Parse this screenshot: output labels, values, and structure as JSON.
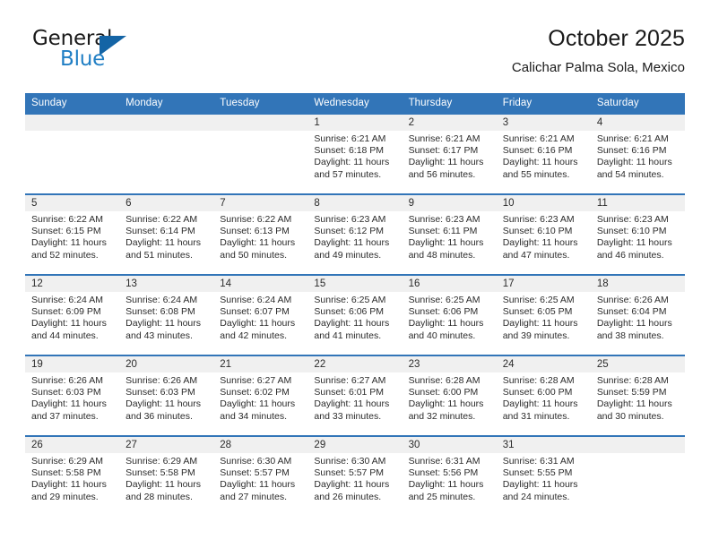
{
  "logo": {
    "word_top": "General",
    "word_bottom": "Blue",
    "accent_color": "#1464a5",
    "blue_text_color": "#1f7ec4",
    "triangle_icon": "logo-triangle-icon"
  },
  "header": {
    "title": "October 2025",
    "subtitle": "Calichar Palma Sola, Mexico"
  },
  "theme": {
    "header_blue": "#3275b8",
    "daynum_band": "#f0f0f0",
    "text": "#2b2b2b"
  },
  "calendar": {
    "weekday_headers": [
      "Sunday",
      "Monday",
      "Tuesday",
      "Wednesday",
      "Thursday",
      "Friday",
      "Saturday"
    ],
    "weeks": [
      [
        {
          "day": "",
          "sunrise": "",
          "sunset": "",
          "daylight": ""
        },
        {
          "day": "",
          "sunrise": "",
          "sunset": "",
          "daylight": ""
        },
        {
          "day": "",
          "sunrise": "",
          "sunset": "",
          "daylight": ""
        },
        {
          "day": "1",
          "sunrise": "Sunrise: 6:21 AM",
          "sunset": "Sunset: 6:18 PM",
          "daylight": "Daylight: 11 hours and 57 minutes."
        },
        {
          "day": "2",
          "sunrise": "Sunrise: 6:21 AM",
          "sunset": "Sunset: 6:17 PM",
          "daylight": "Daylight: 11 hours and 56 minutes."
        },
        {
          "day": "3",
          "sunrise": "Sunrise: 6:21 AM",
          "sunset": "Sunset: 6:16 PM",
          "daylight": "Daylight: 11 hours and 55 minutes."
        },
        {
          "day": "4",
          "sunrise": "Sunrise: 6:21 AM",
          "sunset": "Sunset: 6:16 PM",
          "daylight": "Daylight: 11 hours and 54 minutes."
        }
      ],
      [
        {
          "day": "5",
          "sunrise": "Sunrise: 6:22 AM",
          "sunset": "Sunset: 6:15 PM",
          "daylight": "Daylight: 11 hours and 52 minutes."
        },
        {
          "day": "6",
          "sunrise": "Sunrise: 6:22 AM",
          "sunset": "Sunset: 6:14 PM",
          "daylight": "Daylight: 11 hours and 51 minutes."
        },
        {
          "day": "7",
          "sunrise": "Sunrise: 6:22 AM",
          "sunset": "Sunset: 6:13 PM",
          "daylight": "Daylight: 11 hours and 50 minutes."
        },
        {
          "day": "8",
          "sunrise": "Sunrise: 6:23 AM",
          "sunset": "Sunset: 6:12 PM",
          "daylight": "Daylight: 11 hours and 49 minutes."
        },
        {
          "day": "9",
          "sunrise": "Sunrise: 6:23 AM",
          "sunset": "Sunset: 6:11 PM",
          "daylight": "Daylight: 11 hours and 48 minutes."
        },
        {
          "day": "10",
          "sunrise": "Sunrise: 6:23 AM",
          "sunset": "Sunset: 6:10 PM",
          "daylight": "Daylight: 11 hours and 47 minutes."
        },
        {
          "day": "11",
          "sunrise": "Sunrise: 6:23 AM",
          "sunset": "Sunset: 6:10 PM",
          "daylight": "Daylight: 11 hours and 46 minutes."
        }
      ],
      [
        {
          "day": "12",
          "sunrise": "Sunrise: 6:24 AM",
          "sunset": "Sunset: 6:09 PM",
          "daylight": "Daylight: 11 hours and 44 minutes."
        },
        {
          "day": "13",
          "sunrise": "Sunrise: 6:24 AM",
          "sunset": "Sunset: 6:08 PM",
          "daylight": "Daylight: 11 hours and 43 minutes."
        },
        {
          "day": "14",
          "sunrise": "Sunrise: 6:24 AM",
          "sunset": "Sunset: 6:07 PM",
          "daylight": "Daylight: 11 hours and 42 minutes."
        },
        {
          "day": "15",
          "sunrise": "Sunrise: 6:25 AM",
          "sunset": "Sunset: 6:06 PM",
          "daylight": "Daylight: 11 hours and 41 minutes."
        },
        {
          "day": "16",
          "sunrise": "Sunrise: 6:25 AM",
          "sunset": "Sunset: 6:06 PM",
          "daylight": "Daylight: 11 hours and 40 minutes."
        },
        {
          "day": "17",
          "sunrise": "Sunrise: 6:25 AM",
          "sunset": "Sunset: 6:05 PM",
          "daylight": "Daylight: 11 hours and 39 minutes."
        },
        {
          "day": "18",
          "sunrise": "Sunrise: 6:26 AM",
          "sunset": "Sunset: 6:04 PM",
          "daylight": "Daylight: 11 hours and 38 minutes."
        }
      ],
      [
        {
          "day": "19",
          "sunrise": "Sunrise: 6:26 AM",
          "sunset": "Sunset: 6:03 PM",
          "daylight": "Daylight: 11 hours and 37 minutes."
        },
        {
          "day": "20",
          "sunrise": "Sunrise: 6:26 AM",
          "sunset": "Sunset: 6:03 PM",
          "daylight": "Daylight: 11 hours and 36 minutes."
        },
        {
          "day": "21",
          "sunrise": "Sunrise: 6:27 AM",
          "sunset": "Sunset: 6:02 PM",
          "daylight": "Daylight: 11 hours and 34 minutes."
        },
        {
          "day": "22",
          "sunrise": "Sunrise: 6:27 AM",
          "sunset": "Sunset: 6:01 PM",
          "daylight": "Daylight: 11 hours and 33 minutes."
        },
        {
          "day": "23",
          "sunrise": "Sunrise: 6:28 AM",
          "sunset": "Sunset: 6:00 PM",
          "daylight": "Daylight: 11 hours and 32 minutes."
        },
        {
          "day": "24",
          "sunrise": "Sunrise: 6:28 AM",
          "sunset": "Sunset: 6:00 PM",
          "daylight": "Daylight: 11 hours and 31 minutes."
        },
        {
          "day": "25",
          "sunrise": "Sunrise: 6:28 AM",
          "sunset": "Sunset: 5:59 PM",
          "daylight": "Daylight: 11 hours and 30 minutes."
        }
      ],
      [
        {
          "day": "26",
          "sunrise": "Sunrise: 6:29 AM",
          "sunset": "Sunset: 5:58 PM",
          "daylight": "Daylight: 11 hours and 29 minutes."
        },
        {
          "day": "27",
          "sunrise": "Sunrise: 6:29 AM",
          "sunset": "Sunset: 5:58 PM",
          "daylight": "Daylight: 11 hours and 28 minutes."
        },
        {
          "day": "28",
          "sunrise": "Sunrise: 6:30 AM",
          "sunset": "Sunset: 5:57 PM",
          "daylight": "Daylight: 11 hours and 27 minutes."
        },
        {
          "day": "29",
          "sunrise": "Sunrise: 6:30 AM",
          "sunset": "Sunset: 5:57 PM",
          "daylight": "Daylight: 11 hours and 26 minutes."
        },
        {
          "day": "30",
          "sunrise": "Sunrise: 6:31 AM",
          "sunset": "Sunset: 5:56 PM",
          "daylight": "Daylight: 11 hours and 25 minutes."
        },
        {
          "day": "31",
          "sunrise": "Sunrise: 6:31 AM",
          "sunset": "Sunset: 5:55 PM",
          "daylight": "Daylight: 11 hours and 24 minutes."
        },
        {
          "day": "",
          "sunrise": "",
          "sunset": "",
          "daylight": ""
        }
      ]
    ]
  }
}
